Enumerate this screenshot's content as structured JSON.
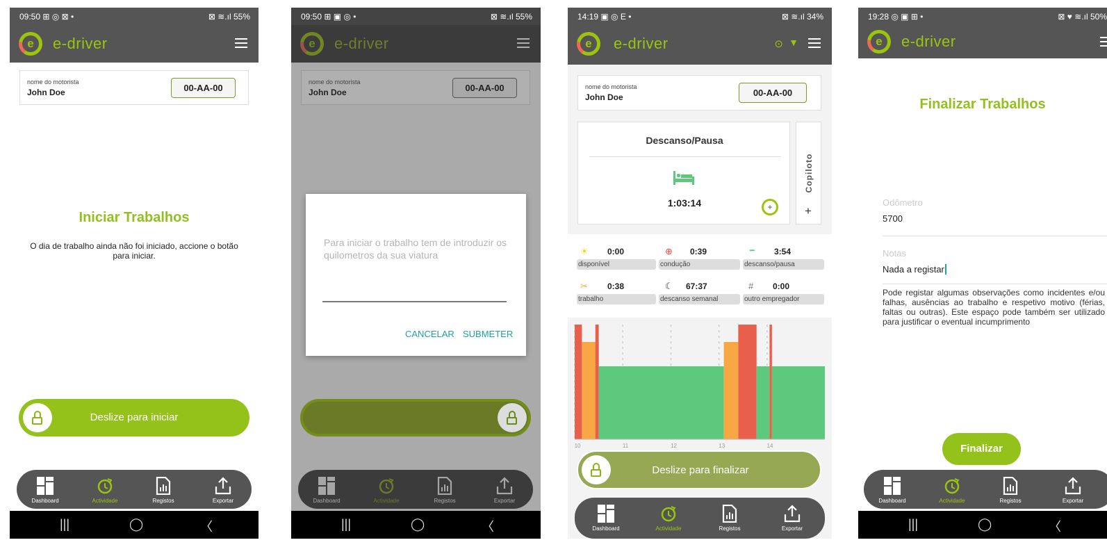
{
  "screens": [
    {
      "status": {
        "time": "09:50",
        "icons": "⊞ ◎ ⊠ •",
        "right": "⊠ ≋.ıl 55%"
      },
      "brand": "e-driver",
      "driver": {
        "label": "nome do motorista",
        "name": "John Doe",
        "plate": "00-AA-00"
      },
      "title": "Iniciar Trabalhos",
      "message": "O dia de trabalho ainda não foi iniciado, accione o botão para iniciar.",
      "slider": "Deslize para iniciar",
      "nav": [
        "Dashboard",
        "Actividade",
        "Registos",
        "Exportar"
      ]
    },
    {
      "status": {
        "time": "09:50",
        "icons": "⊞ ▣ ◎ •",
        "right": "⊠ ≋.ıl 55%"
      },
      "brand": "e-driver",
      "driver": {
        "label": "nome do motorista",
        "name": "John Doe",
        "plate": "00-AA-00"
      },
      "dialog": {
        "text": "Para iniciar o trabalho tem de introduzir os quilometros da sua viatura",
        "cancel": "CANCELAR",
        "submit": "SUBMETER"
      },
      "nav": [
        "Dashboard",
        "Actividade",
        "Registos",
        "Exportar"
      ]
    },
    {
      "status": {
        "time": "14:19",
        "icons": "▣ ◎ E •",
        "right": "⊠ ≋.ıl 34%"
      },
      "brand": "e-driver",
      "driver": {
        "label": "nome do motorista",
        "name": "John Doe",
        "plate": "00-AA-00"
      },
      "activity": {
        "title": "Descanso/Pausa",
        "time": "1:03:14",
        "copilot": "Copiloto"
      },
      "stats": [
        {
          "icon": "sun-icon",
          "symbol": "☀",
          "color": "#f5d020",
          "value": "0:00",
          "label": "disponível"
        },
        {
          "icon": "steering-wheel-icon",
          "symbol": "⊕",
          "color": "#e74c3c",
          "value": "0:39",
          "label": "condução"
        },
        {
          "icon": "bed-icon",
          "symbol": "🛏",
          "color": "#5cc97c",
          "value": "3:54",
          "label": "descanso/pausa"
        },
        {
          "icon": "tools-icon",
          "symbol": "✂",
          "color": "#f5a742",
          "value": "0:38",
          "label": "trabalho"
        },
        {
          "icon": "moon-icon",
          "symbol": "☾",
          "color": "#333",
          "value": "67:37",
          "label": "descanso semanal"
        },
        {
          "icon": "hash-icon",
          "symbol": "#",
          "color": "#777",
          "value": "0:00",
          "label": "outro empregador"
        }
      ],
      "chart_data": {
        "type": "bar",
        "x_ticks": [
          "10",
          "11",
          "12",
          "13",
          "14"
        ],
        "segments": [
          {
            "start": 9.5,
            "end": 9.65,
            "level": "red",
            "color": "#e8604c"
          },
          {
            "start": 9.65,
            "end": 10.0,
            "level": "orange",
            "color": "#f7a744"
          },
          {
            "start": 9.93,
            "end": 10.0,
            "level": "red",
            "color": "#e8604c"
          },
          {
            "start": 10.0,
            "end": 12.6,
            "level": "green",
            "color": "#5cc97c"
          },
          {
            "start": 12.6,
            "end": 12.9,
            "level": "orange",
            "color": "#f7a744"
          },
          {
            "start": 12.9,
            "end": 13.28,
            "level": "red",
            "color": "#e8604c"
          },
          {
            "start": 13.28,
            "end": 13.55,
            "level": "green",
            "color": "#5cc97c"
          },
          {
            "start": 13.55,
            "end": 13.6,
            "level": "red",
            "color": "#e8604c"
          },
          {
            "start": 13.6,
            "end": 14.7,
            "level": "green",
            "color": "#5cc97c"
          }
        ]
      },
      "slider": "Deslize para finalizar",
      "nav": [
        "Dashboard",
        "Actividade",
        "Registos",
        "Exportar"
      ]
    },
    {
      "status": {
        "time": "19:28",
        "icons": "◎ ▣ ⊞ •",
        "right": "⊠ ♥ ≋.ıl 50%"
      },
      "brand": "e-driver",
      "title": "Finalizar Trabalhos",
      "odometer": {
        "label": "Odômetro",
        "value": "5700"
      },
      "notes": {
        "label": "Notas",
        "value": "Nada a registar"
      },
      "help": "Pode registar algumas observações como incidentes e/ou falhas, ausências ao trabalho e respetivo motivo (férias, faltas ou outras). Este espaço pode também ser utilizado para justificar o eventual incumprimento",
      "button": "Finalizar",
      "nav": [
        "Dashboard",
        "Actividade",
        "Registos",
        "Exportar"
      ]
    }
  ],
  "colors": {
    "accent": "#9cc40e",
    "dark": "#555555",
    "title_green": "#93c01f",
    "dialog_text": "#b5b5b5",
    "dialog_button": "#20a09a"
  }
}
